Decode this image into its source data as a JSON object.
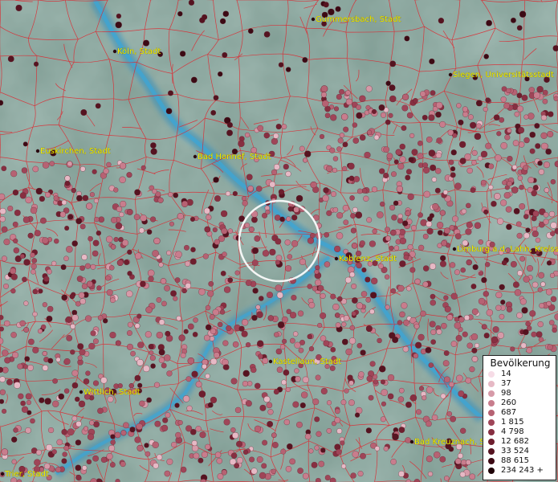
{
  "map": {
    "locate_circle": "selection-circle",
    "cities": [
      {
        "name": "Gummersbach, Stadt"
      },
      {
        "name": "Köln, Stadt"
      },
      {
        "name": "Siegen, Universitätsstadt"
      },
      {
        "name": "Euskirchen, Stadt"
      },
      {
        "name": "Bad Honnef, Stadt"
      },
      {
        "name": "Koblenz, Stadt"
      },
      {
        "name": "Limburg a.d. Lahn, Kreisstadt"
      },
      {
        "name": "Kastellaun, Stadt"
      },
      {
        "name": "Wittlich, Stadt"
      },
      {
        "name": "Bad Kreuznach, Stadt"
      },
      {
        "name": "Trier, Stadt"
      }
    ]
  },
  "legend": {
    "title": "Bevölkerung",
    "items": [
      {
        "label": "14",
        "color": "#f6dce6"
      },
      {
        "label": "37",
        "color": "#e6b9c5"
      },
      {
        "label": "98",
        "color": "#d69aa8"
      },
      {
        "label": "260",
        "color": "#c87d8d"
      },
      {
        "label": "687",
        "color": "#b66273"
      },
      {
        "label": "1 815",
        "color": "#9f4558"
      },
      {
        "label": "4 798",
        "color": "#872f41"
      },
      {
        "label": "12 682",
        "color": "#6e1e2e"
      },
      {
        "label": "33 524",
        "color": "#551320"
      },
      {
        "label": "88 615",
        "color": "#3c0a14"
      },
      {
        "label": "234 243 +",
        "color": "#1f0308"
      }
    ]
  }
}
